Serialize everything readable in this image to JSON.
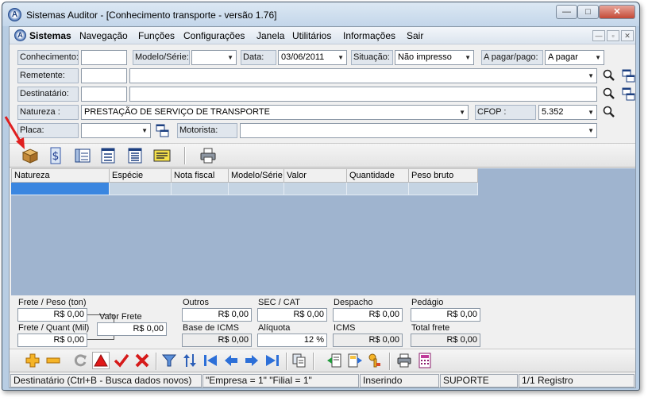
{
  "window": {
    "title": "Sistemas Auditor - [Conhecimento transporte - versão 1.76]",
    "min": "—",
    "max": "□",
    "close": "✕"
  },
  "menu": {
    "logo": "A",
    "items": [
      "Sistemas",
      "Navegação",
      "Funções",
      "Configurações",
      "Janela",
      "Utilitários",
      "Informações",
      "Sair"
    ],
    "mdi": [
      "—",
      "▫",
      "✕"
    ]
  },
  "form": {
    "conhecimento_label": "Conhecimento:",
    "conhecimento_value": "",
    "modelo_label": "Modelo/Série:",
    "modelo_value": "",
    "data_label": "Data:",
    "data_value": "03/06/2011",
    "situacao_label": "Situação:",
    "situacao_value": "Não impresso",
    "apagar_label": "A pagar/pago:",
    "apagar_value": "A pagar",
    "remetente_label": "Remetente:",
    "remetente_code": "",
    "remetente_name": "",
    "destinatario_label": "Destinatário:",
    "destinatario_code": "",
    "destinatario_name": "",
    "natureza_label": "Natureza :",
    "natureza_value": "PRESTAÇÃO DE SERVIÇO DE TRANSPORTE",
    "cfop_label": "CFOP :",
    "cfop_value": "5.352",
    "placa_label": "Placa:",
    "placa_value": "",
    "motorista_label": "Motorista:",
    "motorista_value": ""
  },
  "grid": {
    "columns": [
      "Natureza",
      "Espécie",
      "Nota fiscal",
      "Modelo/Série",
      "Valor",
      "Quantidade",
      "Peso bruto"
    ]
  },
  "totals": {
    "frete_peso_label": "Frete / Peso (ton)",
    "frete_peso_value": "R$ 0,00",
    "frete_quant_label": "Frete / Quant (Mil)",
    "frete_quant_value": "R$ 0,00",
    "valor_frete_label": "Valor Frete",
    "valor_frete_value": "R$ 0,00",
    "outros_label": "Outros",
    "outros_value": "R$ 0,00",
    "base_icms_label": "Base de ICMS",
    "base_icms_value": "R$ 0,00",
    "sec_cat_label": "SEC / CAT",
    "sec_cat_value": "R$ 0,00",
    "aliquota_label": "Alíquota",
    "aliquota_value": "12 %",
    "despacho_label": "Despacho",
    "despacho_value": "R$ 0,00",
    "icms_label": "ICMS",
    "icms_value": "R$ 0,00",
    "pedagio_label": "Pedágio",
    "pedagio_value": "R$ 0,00",
    "total_frete_label": "Total frete",
    "total_frete_value": "R$ 0,00"
  },
  "status": {
    "hint": "Destinatário (Ctrl+B - Busca dados novos)",
    "empresa": "\"Empresa = 1\"   \"Filial = 1\"",
    "mode": "Inserindo",
    "user": "SUPORTE",
    "records": "1/1 Registro"
  },
  "colors": {
    "grid_bg": "#9fb4cf",
    "selected_cell": "#3a86e0",
    "label_bg": "#e0e6ed",
    "annotation_arrow": "#e02020"
  }
}
